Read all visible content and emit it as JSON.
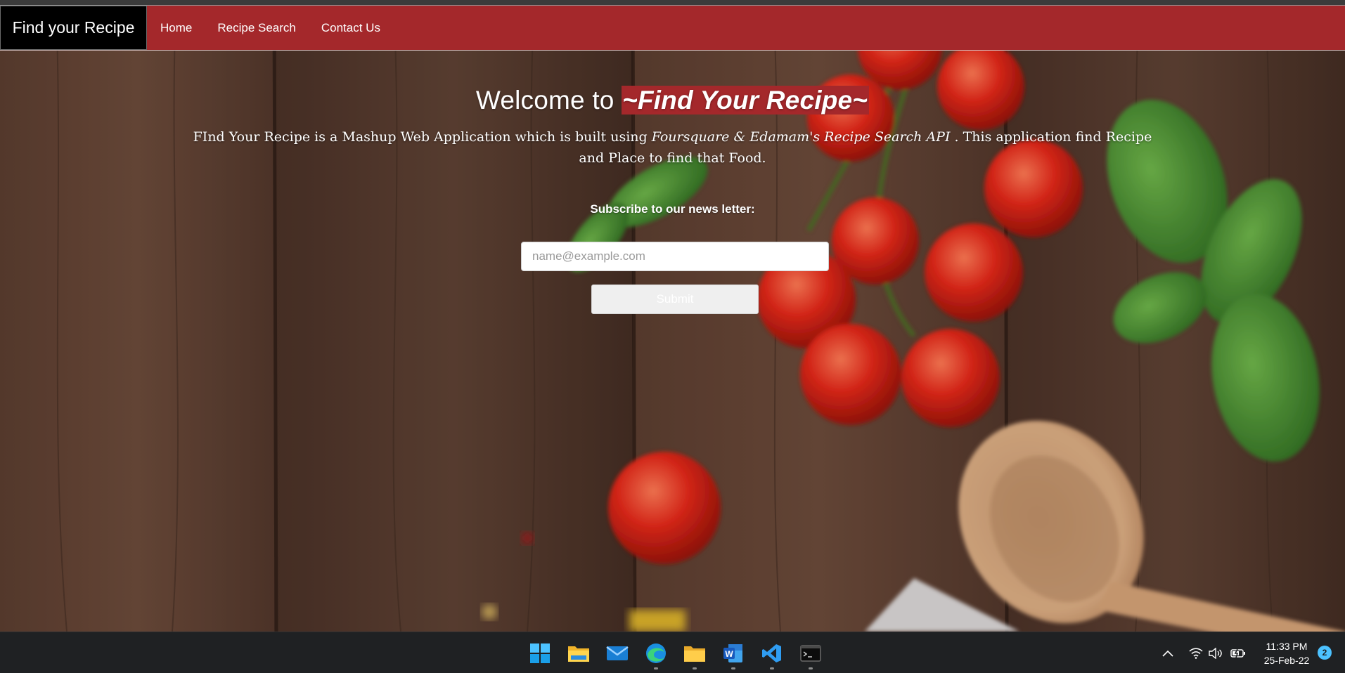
{
  "navbar": {
    "brand": "Find your Recipe",
    "links": [
      "Home",
      "Recipe Search",
      "Contact Us"
    ]
  },
  "hero": {
    "title_prefix": "Welcome to ",
    "title_brand": "~Find Your Recipe~",
    "desc_part1": "FInd Your Recipe is a Mashup Web Application which is built using ",
    "desc_em": "Foursquare & Edamam's Recipe Search API",
    "desc_part2": " . This application find Recipe and Place to find that Food."
  },
  "subscribe": {
    "label": "Subscribe to our news letter:",
    "email_placeholder": "name@example.com",
    "email_value": "",
    "submit_label": "Submit"
  },
  "taskbar": {
    "apps": [
      "start-icon",
      "file-explorer-icon",
      "mail-icon",
      "edge-icon",
      "folder-icon",
      "word-icon",
      "vscode-icon",
      "terminal-icon"
    ],
    "time": "11:33 PM",
    "date": "25-Feb-22",
    "notification_count": "2"
  },
  "colors": {
    "brand_red": "#a4282b",
    "brand_black": "#000000",
    "taskbar": "#1f2123"
  }
}
